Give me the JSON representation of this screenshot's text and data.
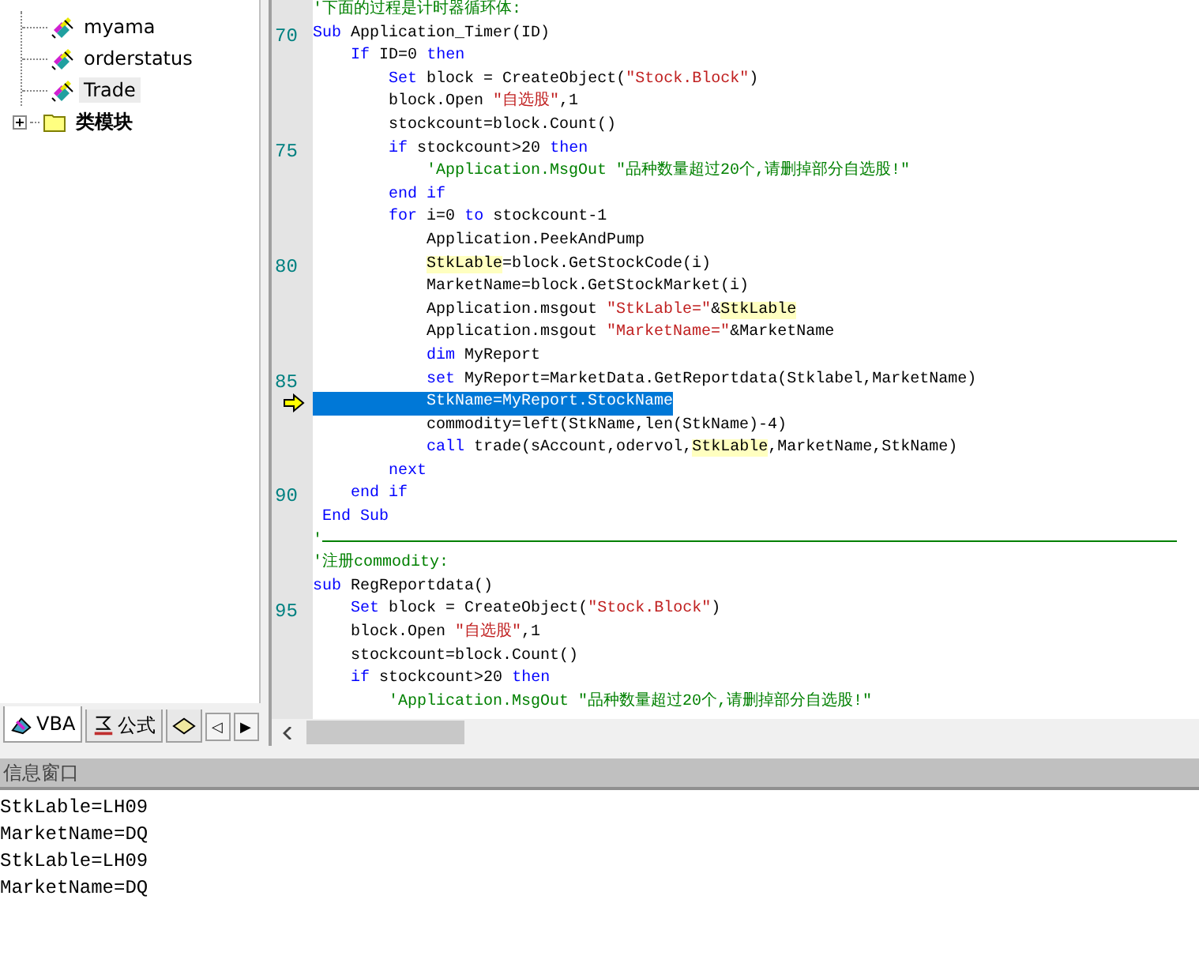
{
  "tree": {
    "items": [
      {
        "label": "myama",
        "selected": false
      },
      {
        "label": "orderstatus",
        "selected": false
      },
      {
        "label": "Trade",
        "selected": true
      }
    ],
    "folder": {
      "label": "类模块",
      "expanded": false
    }
  },
  "bottom_tabs": [
    {
      "label": "VBA",
      "selected": true
    },
    {
      "label": "公式",
      "selected": false
    },
    {
      "selected": false
    }
  ],
  "tab_scroll": {
    "left": "◁",
    "right": "▶"
  },
  "code": {
    "lines": [
      {
        "current": false,
        "tokens": [
          {
            "kind": "cmt",
            "text": "'下面的过程是计时器循环体:"
          }
        ]
      },
      {
        "num": "70",
        "current": false,
        "tokens": [
          {
            "kind": "kw",
            "text": "Sub"
          },
          {
            "kind": "plain",
            "text": " Application_Timer(ID)"
          }
        ]
      },
      {
        "current": false,
        "tokens": [
          {
            "kind": "kw",
            "text": "    If"
          },
          {
            "kind": "plain",
            "text": " ID=0 "
          },
          {
            "kind": "kw",
            "text": "then"
          }
        ]
      },
      {
        "current": false,
        "tokens": [
          {
            "kind": "kw",
            "text": "        Set"
          },
          {
            "kind": "plain",
            "text": " block = CreateObject("
          },
          {
            "kind": "str",
            "text": "\"Stock.Block\""
          },
          {
            "kind": "plain",
            "text": ")"
          }
        ]
      },
      {
        "current": false,
        "tokens": [
          {
            "kind": "plain",
            "text": "        block.Open "
          },
          {
            "kind": "str",
            "text": "\"自选股\""
          },
          {
            "kind": "plain",
            "text": ",1"
          }
        ]
      },
      {
        "current": false,
        "tokens": [
          {
            "kind": "plain",
            "text": "        stockcount=block.Count()"
          }
        ]
      },
      {
        "num": "75",
        "current": false,
        "tokens": [
          {
            "kind": "kw",
            "text": "        if"
          },
          {
            "kind": "plain",
            "text": " stockcount>20 "
          },
          {
            "kind": "kw",
            "text": "then"
          }
        ]
      },
      {
        "current": false,
        "tokens": [
          {
            "kind": "cmt",
            "text": "            'Application.MsgOut \"品种数量超过20个,请删掉部分自选股!\""
          }
        ]
      },
      {
        "current": false,
        "tokens": [
          {
            "kind": "kw",
            "text": "        end if"
          }
        ]
      },
      {
        "current": false,
        "tokens": [
          {
            "kind": "kw",
            "text": "        for"
          },
          {
            "kind": "plain",
            "text": " i=0 "
          },
          {
            "kind": "kw",
            "text": "to"
          },
          {
            "kind": "plain",
            "text": " stockcount-1"
          }
        ]
      },
      {
        "current": false,
        "tokens": [
          {
            "kind": "plain",
            "text": "            Application.PeekAndPump"
          }
        ]
      },
      {
        "num": "80",
        "current": false,
        "tokens": [
          {
            "kind": "hl",
            "text": "            StkLable"
          },
          {
            "kind": "plain",
            "text": "=block.GetStockCode(i)"
          }
        ]
      },
      {
        "current": false,
        "tokens": [
          {
            "kind": "plain",
            "text": "            MarketName=block.GetStockMarket(i)"
          }
        ]
      },
      {
        "current": false,
        "tokens": [
          {
            "kind": "plain",
            "text": "            Application.msgout "
          },
          {
            "kind": "str",
            "text": "\"StkLable=\""
          },
          {
            "kind": "plain",
            "text": "&"
          },
          {
            "kind": "hl",
            "text": "StkLable"
          }
        ]
      },
      {
        "current": false,
        "tokens": [
          {
            "kind": "plain",
            "text": "            Application.msgout "
          },
          {
            "kind": "str",
            "text": "\"MarketName=\""
          },
          {
            "kind": "plain",
            "text": "&MarketName"
          }
        ]
      },
      {
        "current": false,
        "tokens": [
          {
            "kind": "kw",
            "text": "            dim"
          },
          {
            "kind": "plain",
            "text": " MyReport"
          }
        ]
      },
      {
        "num": "85",
        "current": false,
        "tokens": [
          {
            "kind": "kw",
            "text": "            set"
          },
          {
            "kind": "plain",
            "text": " MyReport=MarketData.GetReportdata(Stklabel,MarketName)"
          }
        ]
      },
      {
        "current": true,
        "tokens": [
          {
            "kind": "plain",
            "text": "            StkName=MyReport.StockName"
          }
        ]
      },
      {
        "current": false,
        "tokens": [
          {
            "kind": "plain",
            "text": "            commodity=left(StkName,len(StkName)-4)"
          }
        ]
      },
      {
        "current": false,
        "tokens": [
          {
            "kind": "kw",
            "text": "            call"
          },
          {
            "kind": "plain",
            "text": " trade(sAccount,odervol,"
          },
          {
            "kind": "hl",
            "text": "StkLable"
          },
          {
            "kind": "plain",
            "text": ",MarketName,StkName)"
          }
        ]
      },
      {
        "current": false,
        "tokens": [
          {
            "kind": "kw",
            "text": "        next"
          }
        ]
      },
      {
        "num": "90",
        "current": false,
        "tokens": [
          {
            "kind": "kw",
            "text": "    end if"
          }
        ]
      },
      {
        "current": false,
        "tokens": [
          {
            "kind": "kw",
            "text": " End Sub"
          }
        ]
      },
      {
        "current": false,
        "kind": "rule",
        "tokens": [
          {
            "kind": "cmt",
            "text": "'"
          }
        ]
      },
      {
        "current": false,
        "tokens": [
          {
            "kind": "cmt",
            "text": "'注册commodity:"
          }
        ]
      },
      {
        "current": false,
        "tokens": [
          {
            "kind": "kw",
            "text": "sub"
          },
          {
            "kind": "plain",
            "text": " RegReportdata()"
          }
        ]
      },
      {
        "num": "95",
        "current": false,
        "tokens": [
          {
            "kind": "kw",
            "text": "    Set"
          },
          {
            "kind": "plain",
            "text": " block = CreateObject("
          },
          {
            "kind": "str",
            "text": "\"Stock.Block\""
          },
          {
            "kind": "plain",
            "text": ")"
          }
        ]
      },
      {
        "current": false,
        "tokens": [
          {
            "kind": "plain",
            "text": "    block.Open "
          },
          {
            "kind": "str",
            "text": "\"自选股\""
          },
          {
            "kind": "plain",
            "text": ",1"
          }
        ]
      },
      {
        "current": false,
        "tokens": [
          {
            "kind": "plain",
            "text": "    stockcount=block.Count()"
          }
        ]
      },
      {
        "current": false,
        "tokens": [
          {
            "kind": "kw",
            "text": "    if"
          },
          {
            "kind": "plain",
            "text": " stockcount>20 "
          },
          {
            "kind": "kw",
            "text": "then"
          }
        ]
      },
      {
        "current": false,
        "tokens": [
          {
            "kind": "cmt",
            "text": "        'Application.MsgOut \"品种数量超过20个,请删掉部分自选股!\""
          }
        ]
      }
    ]
  },
  "info_window": {
    "title": "信息窗口",
    "lines": [
      "StkLable=LH09",
      "MarketName=DQ",
      "StkLable=LH09",
      "MarketName=DQ"
    ]
  }
}
